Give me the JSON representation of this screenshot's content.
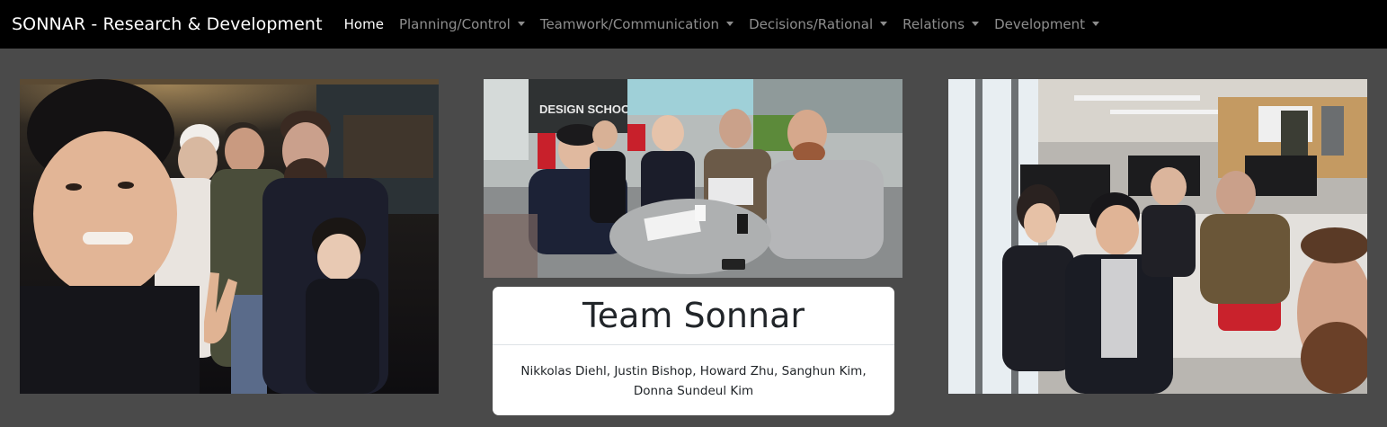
{
  "navbar": {
    "brand": "SONNAR - Research & Development",
    "items": [
      {
        "label": "Home",
        "dropdown": false
      },
      {
        "label": "Planning/Control",
        "dropdown": true
      },
      {
        "label": "Teamwork/Communication",
        "dropdown": true
      },
      {
        "label": "Decisions/Rational",
        "dropdown": true
      },
      {
        "label": "Relations",
        "dropdown": true
      },
      {
        "label": "Development",
        "dropdown": true
      }
    ]
  },
  "card": {
    "title": "Team Sonnar",
    "members": "Nikkolas Diehl, Justin Bishop, Howard Zhu, Sanghun Kim, Donna Sundeul Kim"
  },
  "photos": {
    "center_sign": "DESIGN SCHOOL"
  },
  "colors": {
    "navbar_bg": "#000000",
    "page_bg": "#4a4a4a",
    "card_bg": "#ffffff",
    "nav_active": "#ffffff",
    "nav_inactive": "#8c8c8c"
  }
}
